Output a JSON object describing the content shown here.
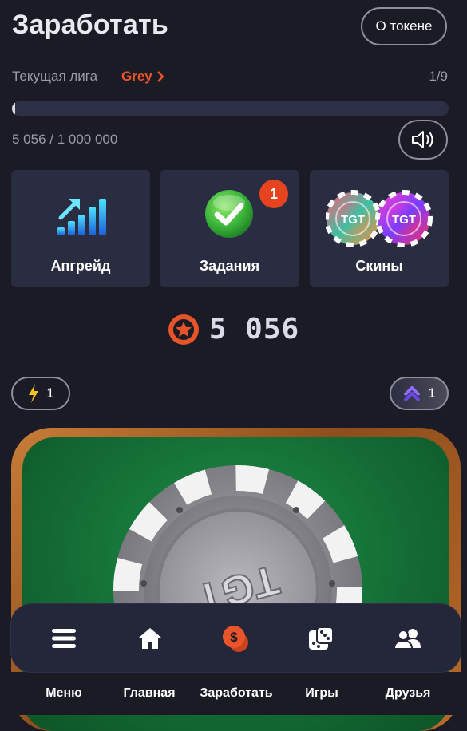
{
  "header": {
    "title": "Заработать",
    "token_button": "О токене"
  },
  "league": {
    "label": "Текущая лига",
    "name": "Grey",
    "count": "1/9",
    "progress_fraction": 0.005056
  },
  "score": {
    "text": "5 056 / 1 000 000"
  },
  "cards": [
    {
      "label": "Апгрейд",
      "icon": "upgrade-bars-icon"
    },
    {
      "label": "Задания",
      "icon": "checkmark-icon",
      "badge": "1"
    },
    {
      "label": "Скины",
      "icon": "chip-skins-icon",
      "chip_text": "TGT"
    }
  ],
  "balance": {
    "value": "5 056",
    "icon": "star-coin-icon"
  },
  "boosts": {
    "energy": {
      "value": "1",
      "icon": "lightning-icon"
    },
    "rank": {
      "value": "1",
      "icon": "chevrons-up-icon"
    }
  },
  "game": {
    "chip_text": "TGT"
  },
  "nav": [
    {
      "label": "Меню",
      "icon": "menu-icon"
    },
    {
      "label": "Главная",
      "icon": "home-icon"
    },
    {
      "label": "Заработать",
      "icon": "coins-icon",
      "active": true
    },
    {
      "label": "Игры",
      "icon": "dice-icon"
    },
    {
      "label": "Друзья",
      "icon": "friends-icon"
    }
  ],
  "colors": {
    "background": "#1b1b26",
    "accent": "#e9542a",
    "card": "#2a2d42"
  }
}
